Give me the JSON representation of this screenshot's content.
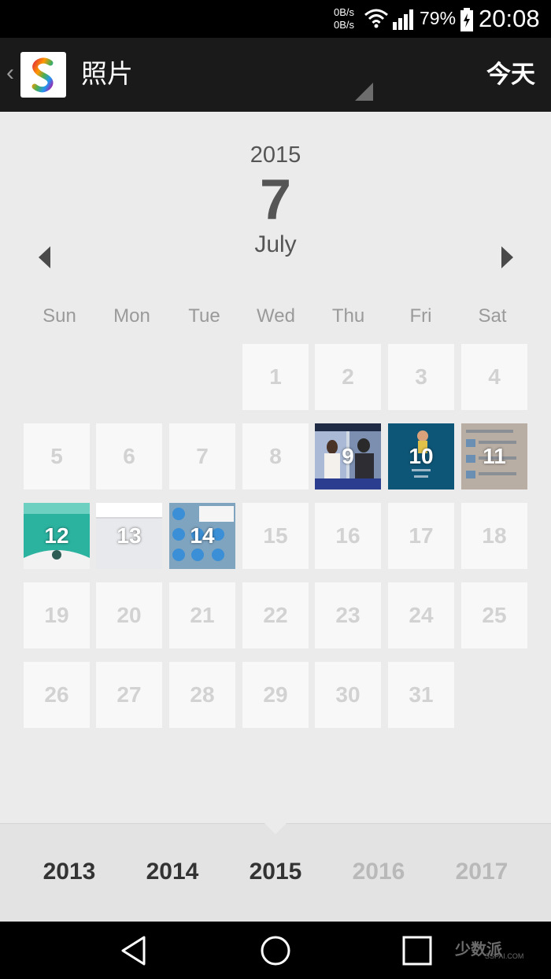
{
  "status": {
    "net_up": "0B/s",
    "net_down": "0B/s",
    "battery": "79%",
    "time": "20:08",
    "icons": [
      "wifi-icon",
      "signal-icon",
      "battery-charging-icon"
    ]
  },
  "appbar": {
    "title": "照片",
    "today_label": "今天",
    "logo_letter": "S"
  },
  "header": {
    "year": "2015",
    "day": "7",
    "month": "July"
  },
  "weekdays": [
    "Sun",
    "Mon",
    "Tue",
    "Wed",
    "Thu",
    "Fri",
    "Sat"
  ],
  "days": [
    "1",
    "2",
    "3",
    "4",
    "5",
    "6",
    "7",
    "8",
    "9",
    "10",
    "11",
    "12",
    "13",
    "14",
    "15",
    "16",
    "17",
    "18",
    "19",
    "20",
    "21",
    "22",
    "23",
    "24",
    "25",
    "26",
    "27",
    "28",
    "29",
    "30",
    "31"
  ],
  "photo_days": [
    "9",
    "10",
    "11",
    "12",
    "13",
    "14"
  ],
  "years": [
    {
      "label": "2013",
      "active": true
    },
    {
      "label": "2014",
      "active": true
    },
    {
      "label": "2015",
      "active": true
    },
    {
      "label": "2016",
      "active": false
    },
    {
      "label": "2017",
      "active": false
    }
  ],
  "watermark": {
    "text": "少数派",
    "sub": "SSPAI.COM"
  },
  "colors": {
    "accent_teal": "#2bb3a0",
    "thumb_blue": "#0e5677"
  }
}
